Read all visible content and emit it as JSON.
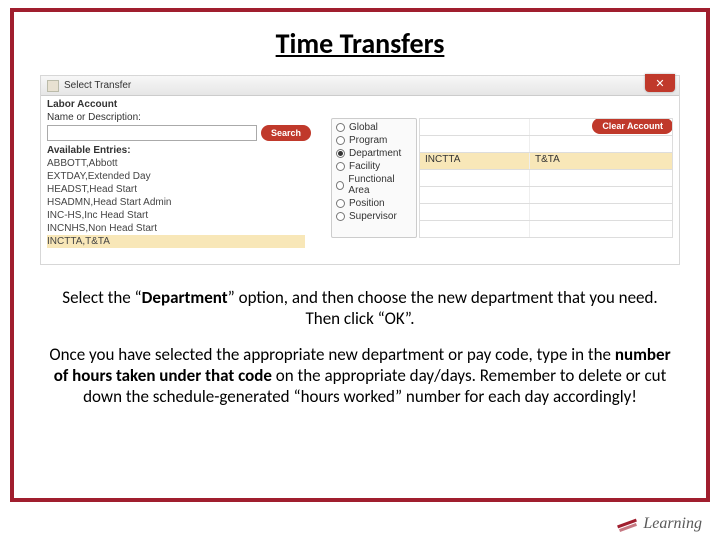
{
  "title": "Time Transfers",
  "dialog": {
    "window_title": "Select Transfer",
    "section_label": "Labor Account",
    "name_desc_label": "Name or Description:",
    "search_btn": "Search",
    "clear_btn": "Clear Account",
    "avail_label": "Available Entries:",
    "entries": [
      {
        "label": "ABBOTT,Abbott",
        "sel": false
      },
      {
        "label": "EXTDAY,Extended Day",
        "sel": false
      },
      {
        "label": "HEADST,Head Start",
        "sel": false
      },
      {
        "label": "HSADMN,Head Start Admin",
        "sel": false
      },
      {
        "label": "INC-HS,Inc Head Start",
        "sel": false
      },
      {
        "label": "INCNHS,Non Head Start",
        "sel": false
      },
      {
        "label": "INCTTA,T&TA",
        "sel": true
      }
    ],
    "radios": [
      {
        "label": "Global",
        "checked": false
      },
      {
        "label": "Program",
        "checked": false
      },
      {
        "label": "Department",
        "checked": true
      },
      {
        "label": "Facility",
        "checked": false
      },
      {
        "label": "Functional Area",
        "checked": false
      },
      {
        "label": "Position",
        "checked": false
      },
      {
        "label": "Supervisor",
        "checked": false
      }
    ],
    "result": {
      "col1": "INCTTA",
      "col2": "T&TA"
    }
  },
  "instructions": {
    "p1_a": "Select the “",
    "p1_bold": "Department",
    "p1_b": "” option, and then choose the new department that you need. Then click “OK”.",
    "p2_a": "Once you have selected the appropriate new department or pay code, type in the ",
    "p2_bold": "number of hours taken under that code",
    "p2_b": " on the appropriate day/days. Remember to delete or cut down the schedule-generated “hours worked” number for each day accordingly!"
  },
  "logo_text": "Learning"
}
